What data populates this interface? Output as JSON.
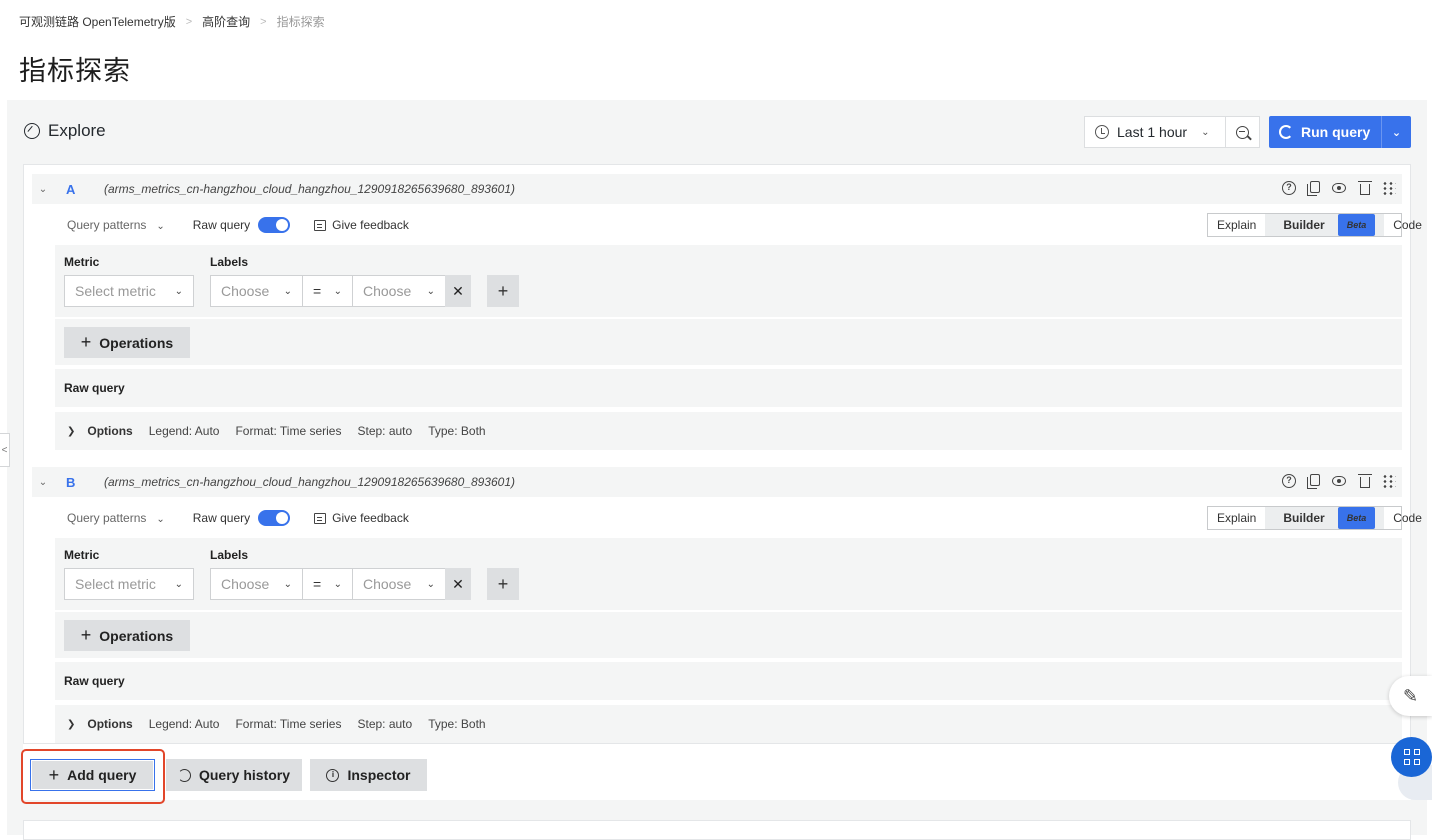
{
  "breadcrumb": [
    "可观测链路 OpenTelemetry版",
    "高阶查询",
    "指标探索"
  ],
  "page_title": "指标探索",
  "explore": {
    "title": "Explore",
    "time_range": "Last 1 hour",
    "run_query": "Run query"
  },
  "queries": [
    {
      "letter": "A",
      "datasource": "(arms_metrics_cn-hangzhou_cloud_hangzhou_1290918265639680_893601)",
      "query_patterns": "Query patterns",
      "raw_query_toggle": "Raw query",
      "give_feedback": "Give feedback",
      "modes": {
        "explain": "Explain",
        "builder": "Builder",
        "beta": "Beta",
        "code": "Code"
      },
      "metric_label": "Metric",
      "metric_placeholder": "Select metric",
      "labels_label": "Labels",
      "label_key_placeholder": "Choose",
      "operator": "=",
      "label_value_placeholder": "Choose",
      "operations": "Operations",
      "raw_query_title": "Raw query",
      "options": {
        "title": "Options",
        "legend": "Legend: Auto",
        "format": "Format: Time series",
        "step": "Step: auto",
        "type": "Type: Both"
      }
    },
    {
      "letter": "B",
      "datasource": "(arms_metrics_cn-hangzhou_cloud_hangzhou_1290918265639680_893601)",
      "query_patterns": "Query patterns",
      "raw_query_toggle": "Raw query",
      "give_feedback": "Give feedback",
      "modes": {
        "explain": "Explain",
        "builder": "Builder",
        "beta": "Beta",
        "code": "Code"
      },
      "metric_label": "Metric",
      "metric_placeholder": "Select metric",
      "labels_label": "Labels",
      "label_key_placeholder": "Choose",
      "operator": "=",
      "label_value_placeholder": "Choose",
      "operations": "Operations",
      "raw_query_title": "Raw query",
      "options": {
        "title": "Options",
        "legend": "Legend: Auto",
        "format": "Format: Time series",
        "step": "Step: auto",
        "type": "Type: Both"
      }
    }
  ],
  "bottom_actions": {
    "add_query": "Add query",
    "query_history": "Query history",
    "inspector": "Inspector"
  },
  "colors": {
    "accent": "#3872eb",
    "highlight": "#e2462a",
    "fab": "#1a66d6"
  },
  "icons": [
    "compass-icon",
    "clock-icon",
    "zoom-out-icon",
    "refresh-icon",
    "help-icon",
    "copy-icon",
    "eye-icon",
    "trash-icon",
    "drag-icon",
    "feedback-icon",
    "history-icon",
    "info-icon",
    "edit-icon",
    "grid-icon"
  ]
}
